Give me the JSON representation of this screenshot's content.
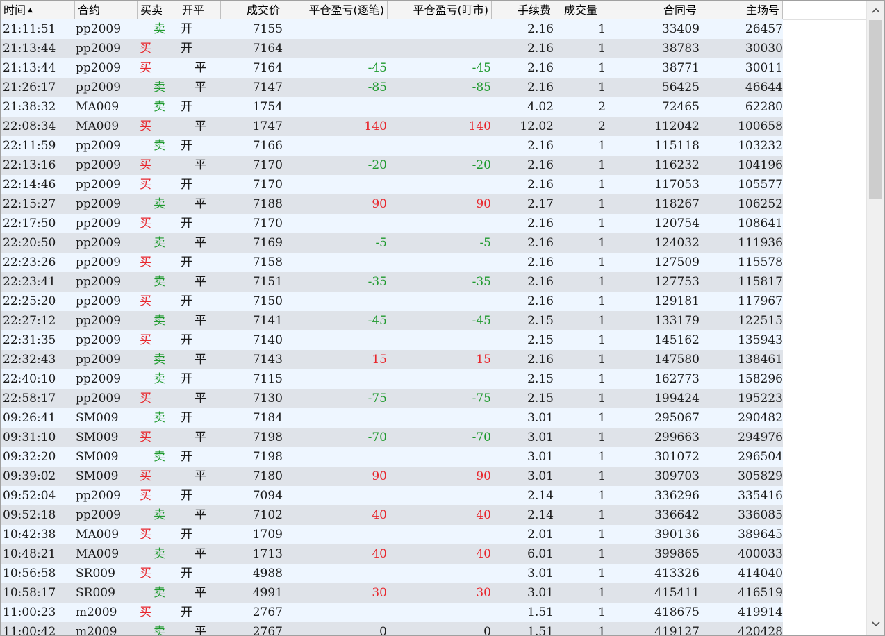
{
  "columns": [
    {
      "key": "time",
      "label": "时间"
    },
    {
      "key": "contract",
      "label": "合约"
    },
    {
      "key": "side",
      "label": "买卖"
    },
    {
      "key": "oc",
      "label": "开平"
    },
    {
      "key": "price",
      "label": "成交价"
    },
    {
      "key": "pnl_trade",
      "label": "平仓盈亏(逐笔)"
    },
    {
      "key": "pnl_mtm",
      "label": "平仓盈亏(盯市)"
    },
    {
      "key": "fee",
      "label": "手续费"
    },
    {
      "key": "qty",
      "label": "成交量"
    },
    {
      "key": "contract_no",
      "label": "合同号"
    },
    {
      "key": "exchange_no",
      "label": "主场号"
    }
  ],
  "sort": {
    "column": "time",
    "direction": "ascending",
    "icon": "sort-ascending-icon"
  },
  "colors": {
    "buy": "#e8262c",
    "sell": "#1f9a2e",
    "row_odd": "#eef6ff",
    "row_even": "#dfe3e9",
    "profit": "#e8262c",
    "loss": "#1f9a2e"
  },
  "icons": {
    "scroll_up": "chevron-up-icon",
    "scroll_down": "chevron-down-icon"
  },
  "scroll": {
    "position_fraction": 0.0,
    "visible_fraction": 0.3
  },
  "rows": [
    {
      "time": "21:11:51",
      "contract": "pp2009",
      "side": "卖",
      "oc": "开",
      "price": "7155",
      "pnl_trade": "",
      "pnl_mtm": "",
      "fee": "2.16",
      "qty": "1",
      "contract_no": "33409",
      "exchange_no": "26457"
    },
    {
      "time": "21:13:44",
      "contract": "pp2009",
      "side": "买",
      "oc": "开",
      "price": "7164",
      "pnl_trade": "",
      "pnl_mtm": "",
      "fee": "2.16",
      "qty": "1",
      "contract_no": "38783",
      "exchange_no": "30030"
    },
    {
      "time": "21:13:44",
      "contract": "pp2009",
      "side": "买",
      "oc": "平",
      "price": "7164",
      "pnl_trade": "-45",
      "pnl_mtm": "-45",
      "fee": "2.16",
      "qty": "1",
      "contract_no": "38771",
      "exchange_no": "30011"
    },
    {
      "time": "21:26:17",
      "contract": "pp2009",
      "side": "卖",
      "oc": "平",
      "price": "7147",
      "pnl_trade": "-85",
      "pnl_mtm": "-85",
      "fee": "2.16",
      "qty": "1",
      "contract_no": "56425",
      "exchange_no": "46644"
    },
    {
      "time": "21:38:32",
      "contract": "MA009",
      "side": "卖",
      "oc": "开",
      "price": "1754",
      "pnl_trade": "",
      "pnl_mtm": "",
      "fee": "4.02",
      "qty": "2",
      "contract_no": "72465",
      "exchange_no": "62280"
    },
    {
      "time": "22:08:34",
      "contract": "MA009",
      "side": "买",
      "oc": "平",
      "price": "1747",
      "pnl_trade": "140",
      "pnl_mtm": "140",
      "fee": "12.02",
      "qty": "2",
      "contract_no": "112042",
      "exchange_no": "100658"
    },
    {
      "time": "22:11:59",
      "contract": "pp2009",
      "side": "卖",
      "oc": "开",
      "price": "7166",
      "pnl_trade": "",
      "pnl_mtm": "",
      "fee": "2.16",
      "qty": "1",
      "contract_no": "115118",
      "exchange_no": "103232"
    },
    {
      "time": "22:13:16",
      "contract": "pp2009",
      "side": "买",
      "oc": "平",
      "price": "7170",
      "pnl_trade": "-20",
      "pnl_mtm": "-20",
      "fee": "2.16",
      "qty": "1",
      "contract_no": "116232",
      "exchange_no": "104196"
    },
    {
      "time": "22:14:46",
      "contract": "pp2009",
      "side": "买",
      "oc": "开",
      "price": "7170",
      "pnl_trade": "",
      "pnl_mtm": "",
      "fee": "2.16",
      "qty": "1",
      "contract_no": "117053",
      "exchange_no": "105577"
    },
    {
      "time": "22:15:27",
      "contract": "pp2009",
      "side": "卖",
      "oc": "平",
      "price": "7188",
      "pnl_trade": "90",
      "pnl_mtm": "90",
      "fee": "2.17",
      "qty": "1",
      "contract_no": "118267",
      "exchange_no": "106252"
    },
    {
      "time": "22:17:50",
      "contract": "pp2009",
      "side": "买",
      "oc": "开",
      "price": "7170",
      "pnl_trade": "",
      "pnl_mtm": "",
      "fee": "2.16",
      "qty": "1",
      "contract_no": "120754",
      "exchange_no": "108641"
    },
    {
      "time": "22:20:50",
      "contract": "pp2009",
      "side": "卖",
      "oc": "平",
      "price": "7169",
      "pnl_trade": "-5",
      "pnl_mtm": "-5",
      "fee": "2.16",
      "qty": "1",
      "contract_no": "124032",
      "exchange_no": "111936"
    },
    {
      "time": "22:23:26",
      "contract": "pp2009",
      "side": "买",
      "oc": "开",
      "price": "7158",
      "pnl_trade": "",
      "pnl_mtm": "",
      "fee": "2.16",
      "qty": "1",
      "contract_no": "127509",
      "exchange_no": "115578"
    },
    {
      "time": "22:23:41",
      "contract": "pp2009",
      "side": "卖",
      "oc": "平",
      "price": "7151",
      "pnl_trade": "-35",
      "pnl_mtm": "-35",
      "fee": "2.16",
      "qty": "1",
      "contract_no": "127753",
      "exchange_no": "115817"
    },
    {
      "time": "22:25:20",
      "contract": "pp2009",
      "side": "买",
      "oc": "开",
      "price": "7150",
      "pnl_trade": "",
      "pnl_mtm": "",
      "fee": "2.16",
      "qty": "1",
      "contract_no": "129181",
      "exchange_no": "117967"
    },
    {
      "time": "22:27:12",
      "contract": "pp2009",
      "side": "卖",
      "oc": "平",
      "price": "7141",
      "pnl_trade": "-45",
      "pnl_mtm": "-45",
      "fee": "2.15",
      "qty": "1",
      "contract_no": "133179",
      "exchange_no": "122515"
    },
    {
      "time": "22:31:35",
      "contract": "pp2009",
      "side": "买",
      "oc": "开",
      "price": "7140",
      "pnl_trade": "",
      "pnl_mtm": "",
      "fee": "2.15",
      "qty": "1",
      "contract_no": "145162",
      "exchange_no": "135943"
    },
    {
      "time": "22:32:43",
      "contract": "pp2009",
      "side": "卖",
      "oc": "平",
      "price": "7143",
      "pnl_trade": "15",
      "pnl_mtm": "15",
      "fee": "2.16",
      "qty": "1",
      "contract_no": "147580",
      "exchange_no": "138461"
    },
    {
      "time": "22:40:10",
      "contract": "pp2009",
      "side": "卖",
      "oc": "开",
      "price": "7115",
      "pnl_trade": "",
      "pnl_mtm": "",
      "fee": "2.15",
      "qty": "1",
      "contract_no": "162773",
      "exchange_no": "158296"
    },
    {
      "time": "22:58:17",
      "contract": "pp2009",
      "side": "买",
      "oc": "平",
      "price": "7130",
      "pnl_trade": "-75",
      "pnl_mtm": "-75",
      "fee": "2.15",
      "qty": "1",
      "contract_no": "199424",
      "exchange_no": "195223"
    },
    {
      "time": "09:26:41",
      "contract": "SM009",
      "side": "卖",
      "oc": "开",
      "price": "7184",
      "pnl_trade": "",
      "pnl_mtm": "",
      "fee": "3.01",
      "qty": "1",
      "contract_no": "295067",
      "exchange_no": "290482"
    },
    {
      "time": "09:31:10",
      "contract": "SM009",
      "side": "买",
      "oc": "平",
      "price": "7198",
      "pnl_trade": "-70",
      "pnl_mtm": "-70",
      "fee": "3.01",
      "qty": "1",
      "contract_no": "299663",
      "exchange_no": "294976"
    },
    {
      "time": "09:32:20",
      "contract": "SM009",
      "side": "卖",
      "oc": "开",
      "price": "7198",
      "pnl_trade": "",
      "pnl_mtm": "",
      "fee": "3.01",
      "qty": "1",
      "contract_no": "301072",
      "exchange_no": "296504"
    },
    {
      "time": "09:39:02",
      "contract": "SM009",
      "side": "买",
      "oc": "平",
      "price": "7180",
      "pnl_trade": "90",
      "pnl_mtm": "90",
      "fee": "3.01",
      "qty": "1",
      "contract_no": "309703",
      "exchange_no": "305829"
    },
    {
      "time": "09:52:04",
      "contract": "pp2009",
      "side": "买",
      "oc": "开",
      "price": "7094",
      "pnl_trade": "",
      "pnl_mtm": "",
      "fee": "2.14",
      "qty": "1",
      "contract_no": "336296",
      "exchange_no": "335416"
    },
    {
      "time": "09:52:18",
      "contract": "pp2009",
      "side": "卖",
      "oc": "平",
      "price": "7102",
      "pnl_trade": "40",
      "pnl_mtm": "40",
      "fee": "2.14",
      "qty": "1",
      "contract_no": "336642",
      "exchange_no": "336085"
    },
    {
      "time": "10:42:38",
      "contract": "MA009",
      "side": "买",
      "oc": "开",
      "price": "1709",
      "pnl_trade": "",
      "pnl_mtm": "",
      "fee": "2.01",
      "qty": "1",
      "contract_no": "390136",
      "exchange_no": "389645"
    },
    {
      "time": "10:48:21",
      "contract": "MA009",
      "side": "卖",
      "oc": "平",
      "price": "1713",
      "pnl_trade": "40",
      "pnl_mtm": "40",
      "fee": "6.01",
      "qty": "1",
      "contract_no": "399865",
      "exchange_no": "400033"
    },
    {
      "time": "10:56:58",
      "contract": "SR009",
      "side": "买",
      "oc": "开",
      "price": "4988",
      "pnl_trade": "",
      "pnl_mtm": "",
      "fee": "3.01",
      "qty": "1",
      "contract_no": "413326",
      "exchange_no": "414040"
    },
    {
      "time": "10:58:17",
      "contract": "SR009",
      "side": "卖",
      "oc": "平",
      "price": "4991",
      "pnl_trade": "30",
      "pnl_mtm": "30",
      "fee": "3.01",
      "qty": "1",
      "contract_no": "415411",
      "exchange_no": "416519"
    },
    {
      "time": "11:00:23",
      "contract": "m2009",
      "side": "买",
      "oc": "开",
      "price": "2767",
      "pnl_trade": "",
      "pnl_mtm": "",
      "fee": "1.51",
      "qty": "1",
      "contract_no": "418675",
      "exchange_no": "419914"
    },
    {
      "time": "11:00:42",
      "contract": "m2009",
      "side": "卖",
      "oc": "平",
      "price": "2767",
      "pnl_trade": "0",
      "pnl_mtm": "0",
      "fee": "1.51",
      "qty": "1",
      "contract_no": "419127",
      "exchange_no": "420428"
    }
  ]
}
